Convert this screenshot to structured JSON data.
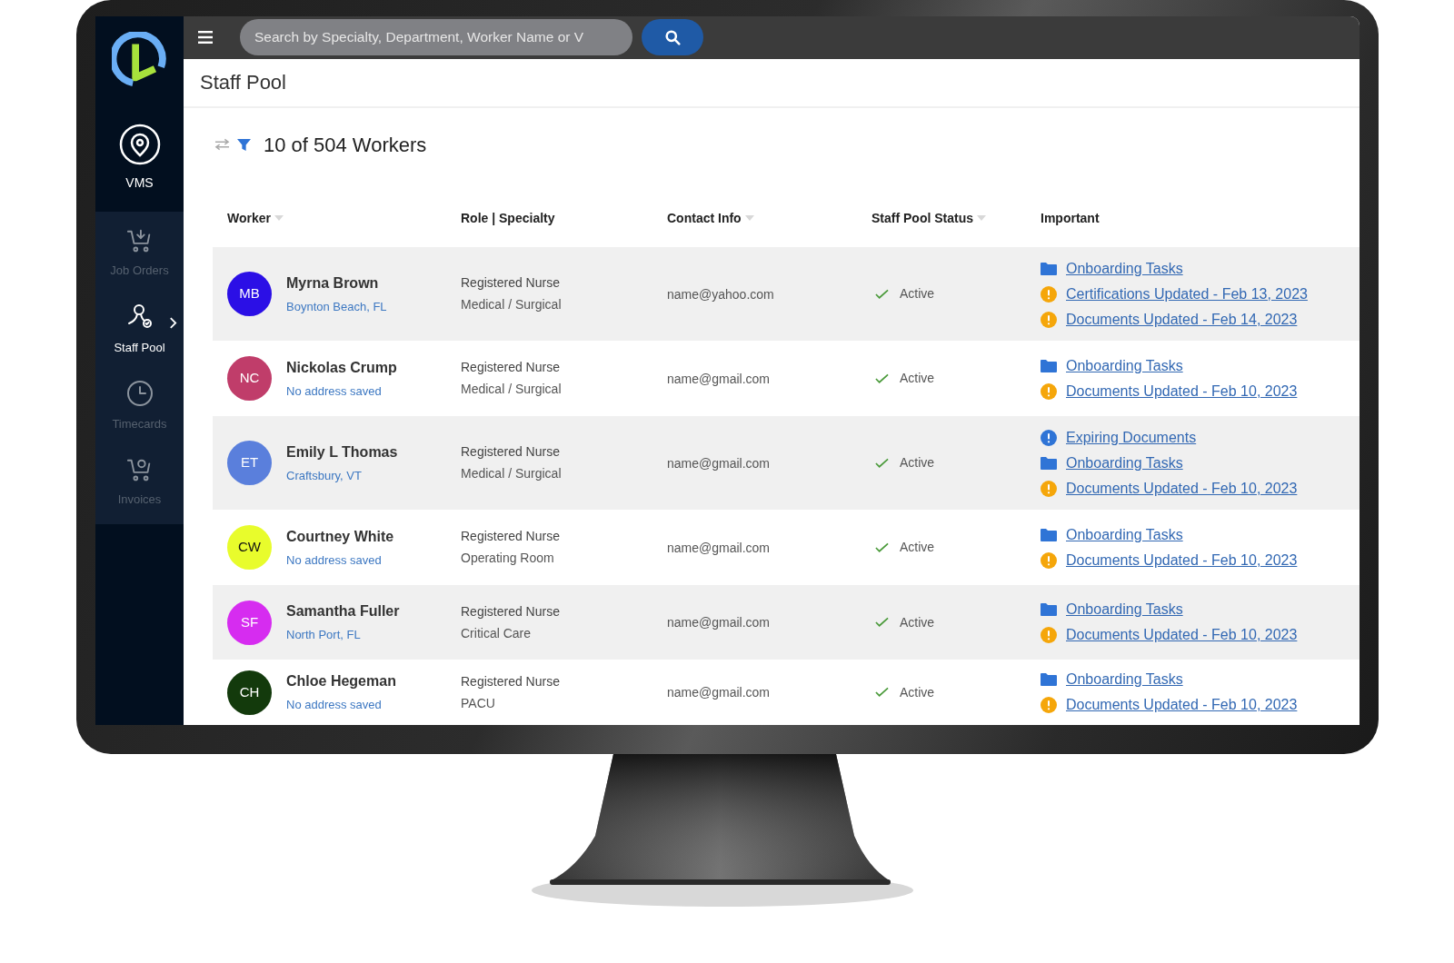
{
  "sidebar": {
    "module": {
      "label": "VMS"
    },
    "items": [
      {
        "label": "Job Orders",
        "kind": "cart-download",
        "selected": false
      },
      {
        "label": "Staff Pool",
        "kind": "person-check",
        "selected": true
      },
      {
        "label": "Timecards",
        "kind": "clock",
        "selected": false
      },
      {
        "label": "Invoices",
        "kind": "cart-check",
        "selected": false
      }
    ]
  },
  "search": {
    "placeholder": "Search by Specialty, Department, Worker Name or V"
  },
  "page_title": "Staff Pool",
  "count": "10 of 504 Workers",
  "table": {
    "columns": [
      {
        "label": "Worker",
        "sortable": true
      },
      {
        "label": "Role | Specialty",
        "sortable": false
      },
      {
        "label": "Contact Info",
        "sortable": true
      },
      {
        "label": "Staff Pool Status",
        "sortable": true
      },
      {
        "label": "Important",
        "sortable": false
      }
    ],
    "rows": [
      {
        "initials": "MB",
        "color": "#2b0fe6",
        "name": "Myrna Brown",
        "location": "Boynton Beach, FL",
        "role": "Registered Nurse",
        "specialty": "Medical / Surgical",
        "contact": "name@yahoo.com",
        "status": "Active",
        "important": [
          {
            "kind": "folder",
            "text": "Onboarding Tasks"
          },
          {
            "kind": "warning",
            "text": "Certifications Updated - Feb 13, 2023"
          },
          {
            "kind": "warning",
            "text": "Documents Updated - Feb 14, 2023"
          }
        ]
      },
      {
        "initials": "NC",
        "color": "#c03d6a",
        "name": "Nickolas Crump",
        "location": "No address saved",
        "role": "Registered Nurse",
        "specialty": "Medical / Surgical",
        "contact": "name@gmail.com",
        "status": "Active",
        "important": [
          {
            "kind": "folder",
            "text": "Onboarding Tasks"
          },
          {
            "kind": "warning",
            "text": "Documents Updated - Feb 10, 2023"
          }
        ]
      },
      {
        "initials": "ET",
        "color": "#5a7fdc",
        "name": "Emily L Thomas",
        "location": "Craftsbury, VT",
        "role": "Registered Nurse",
        "specialty": "Medical / Surgical",
        "contact": "name@gmail.com",
        "status": "Active",
        "important": [
          {
            "kind": "info",
            "text": "Expiring Documents"
          },
          {
            "kind": "folder",
            "text": "Onboarding Tasks"
          },
          {
            "kind": "warning",
            "text": "Documents Updated - Feb 10, 2023"
          }
        ]
      },
      {
        "initials": "CW",
        "color": "#e8fc2c",
        "name": "Courtney White",
        "location": "No address saved",
        "role": "Registered Nurse",
        "specialty": "Operating Room",
        "contact": "name@gmail.com",
        "status": "Active",
        "important": [
          {
            "kind": "folder",
            "text": "Onboarding Tasks"
          },
          {
            "kind": "warning",
            "text": "Documents Updated - Feb 10, 2023"
          }
        ]
      },
      {
        "initials": "SF",
        "color": "#d62cf0",
        "name": "Samantha Fuller",
        "location": "North Port, FL",
        "role": "Registered Nurse",
        "specialty": "Critical Care",
        "contact": "name@gmail.com",
        "status": "Active",
        "important": [
          {
            "kind": "folder",
            "text": "Onboarding Tasks"
          },
          {
            "kind": "warning",
            "text": "Documents Updated - Feb 10, 2023"
          }
        ]
      },
      {
        "initials": "CH",
        "color": "#133a0c",
        "name": "Chloe Hegeman",
        "location": "No address saved",
        "role": "Registered Nurse",
        "specialty": "PACU",
        "contact": "name@gmail.com",
        "status": "Active",
        "important": [
          {
            "kind": "folder",
            "text": "Onboarding Tasks"
          },
          {
            "kind": "warning",
            "text": "Documents Updated - Feb 10, 2023"
          }
        ]
      }
    ]
  }
}
